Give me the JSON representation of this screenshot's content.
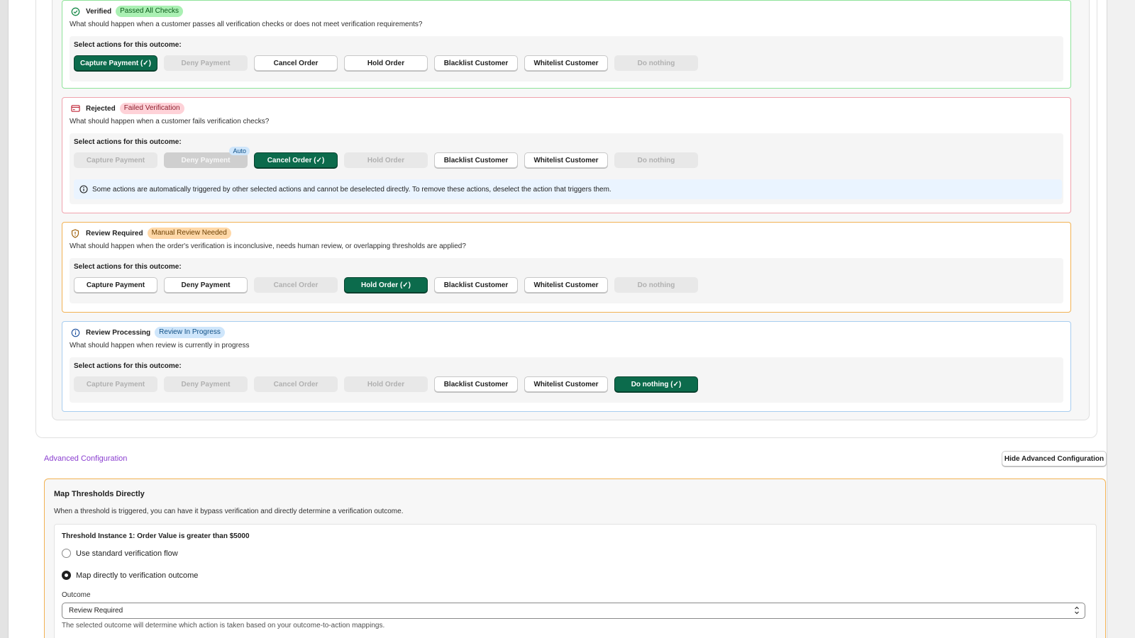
{
  "actions_label": "Select actions for this outcome:",
  "outcomes": [
    {
      "title": "Verified",
      "badge": "Passed All Checks",
      "description": "What should happen when a customer passes all verification checks or does not meet verification requirements?",
      "actions": [
        "Capture Payment (✓)",
        "Deny Payment",
        "Cancel Order",
        "Hold Order",
        "Blacklist Customer",
        "Whitelist Customer",
        "Do nothing"
      ]
    },
    {
      "title": "Rejected",
      "badge": "Failed Verification",
      "description": "What should happen when a customer fails verification checks?",
      "actions": [
        "Capture Payment",
        "Deny Payment",
        "Cancel Order (✓)",
        "Hold Order",
        "Blacklist Customer",
        "Whitelist Customer",
        "Do nothing"
      ],
      "auto_tag": "Auto",
      "info": "Some actions are automatically triggered by other selected actions and cannot be deselected directly. To remove these actions, deselect the action that triggers them."
    },
    {
      "title": "Review Required",
      "badge": "Manual Review Needed",
      "description": "What should happen when the order's verification is inconclusive, needs human review, or overlapping thresholds are applied?",
      "actions": [
        "Capture Payment",
        "Deny Payment",
        "Cancel Order",
        "Hold Order (✓)",
        "Blacklist Customer",
        "Whitelist Customer",
        "Do nothing"
      ]
    },
    {
      "title": "Review Processing",
      "badge": "Review In Progress",
      "description": "What should happen when review is currently in progress",
      "actions": [
        "Capture Payment",
        "Deny Payment",
        "Cancel Order",
        "Hold Order",
        "Blacklist Customer",
        "Whitelist Customer",
        "Do nothing (✓)"
      ]
    }
  ],
  "advanced": {
    "link": "Advanced Configuration",
    "hide_button": "Hide Advanced Configuration"
  },
  "map": {
    "title": "Map Thresholds Directly",
    "description": "When a threshold is triggered, you can have it bypass verification and directly determine a verification outcome.",
    "threshold_title": "Threshold Instance 1: Order Value is greater than $5000",
    "option_standard": "Use standard verification flow",
    "option_direct": "Map directly to verification outcome",
    "outcome_label": "Outcome",
    "outcome_value": "Review Required",
    "help": "The selected outcome will determine which action is taken based on your outcome-to-action mappings."
  },
  "colors": {
    "selected": "#0c6b4c",
    "verified_border": "#8fe39a",
    "rejected_border": "#f0a3ad",
    "review_border": "#f2b253",
    "processing_border": "#a8cdef",
    "link": "#8b3fd0"
  },
  "icons": {
    "verified": "check-circle-icon",
    "rejected": "credit-card-x-icon",
    "review": "shield-alert-icon",
    "processing": "info-circle-icon",
    "info": "info-circle-icon",
    "select": "chevron-up-down-icon",
    "collapse": "chevron-up-icon"
  }
}
